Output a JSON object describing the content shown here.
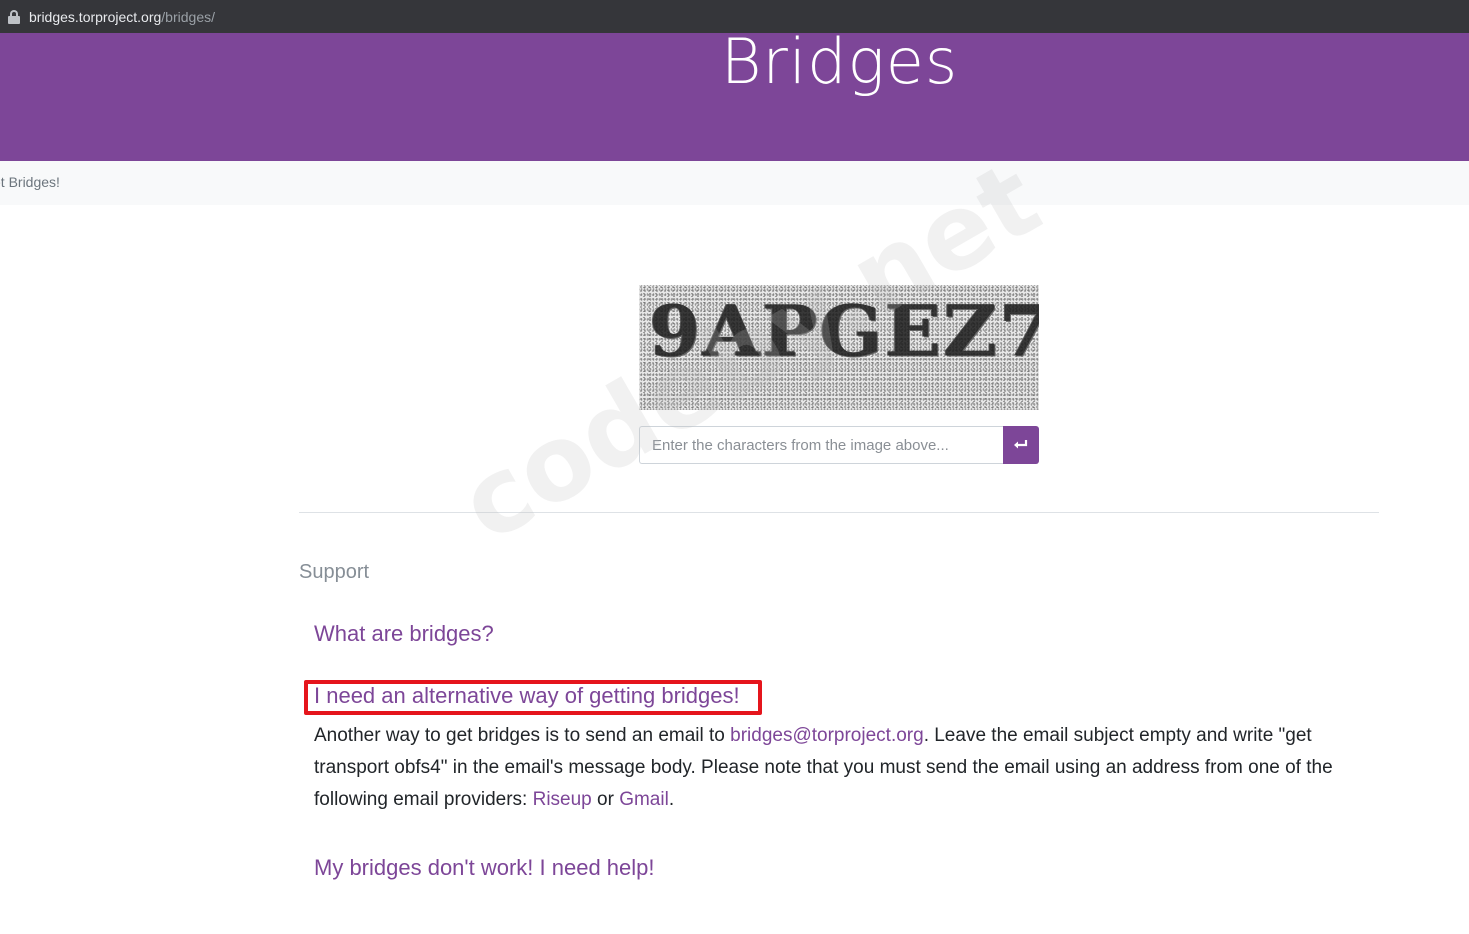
{
  "browser": {
    "url_host": "bridges.torproject.org",
    "url_path": "/bridges/"
  },
  "hero": {
    "title": "Bridges"
  },
  "breadcrumb": {
    "text": "et Bridges!"
  },
  "captcha": {
    "image_text": "9APGEZ7",
    "input_placeholder": "Enter the characters from the image above...",
    "submit_icon": "enter-return-icon"
  },
  "support": {
    "label": "Support",
    "faq": [
      {
        "question": "What are bridges?"
      },
      {
        "question": "I need an alternative way of getting bridges!",
        "answer": {
          "part1": "Another way to get bridges is to send an email to ",
          "email_link": "bridges@torproject.org",
          "part2": ". Leave the email subject empty and write \"get transport obfs4\" in the email's message body. Please note that you must send the email using an address from one of the following email providers: ",
          "riseup_link": "Riseup",
          "part3": " or ",
          "gmail_link": "Gmail",
          "part4": "."
        }
      },
      {
        "question": "My bridges don't work! I need help!"
      }
    ]
  },
  "watermark": {
    "text": "codeby.net"
  },
  "colors": {
    "brand_purple": "#7d4698",
    "highlight_red": "#e5151c"
  }
}
